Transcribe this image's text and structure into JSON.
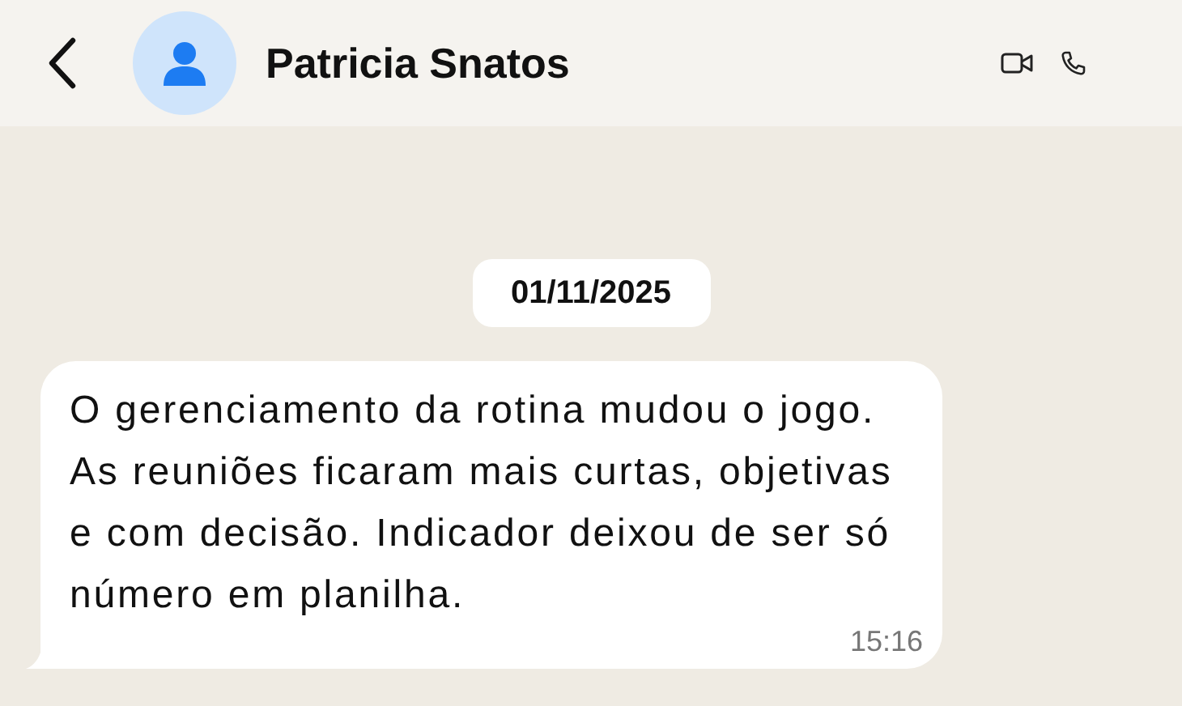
{
  "header": {
    "contact_name": "Patricia Snatos"
  },
  "date_separator": "01/11/2025",
  "messages": [
    {
      "text": "O gerenciamento da rotina mudou o jogo. As reuniões ficaram mais curtas, objetivas e com decisão. Indicador deixou de ser só número em planilha.",
      "time": "15:16"
    }
  ]
}
